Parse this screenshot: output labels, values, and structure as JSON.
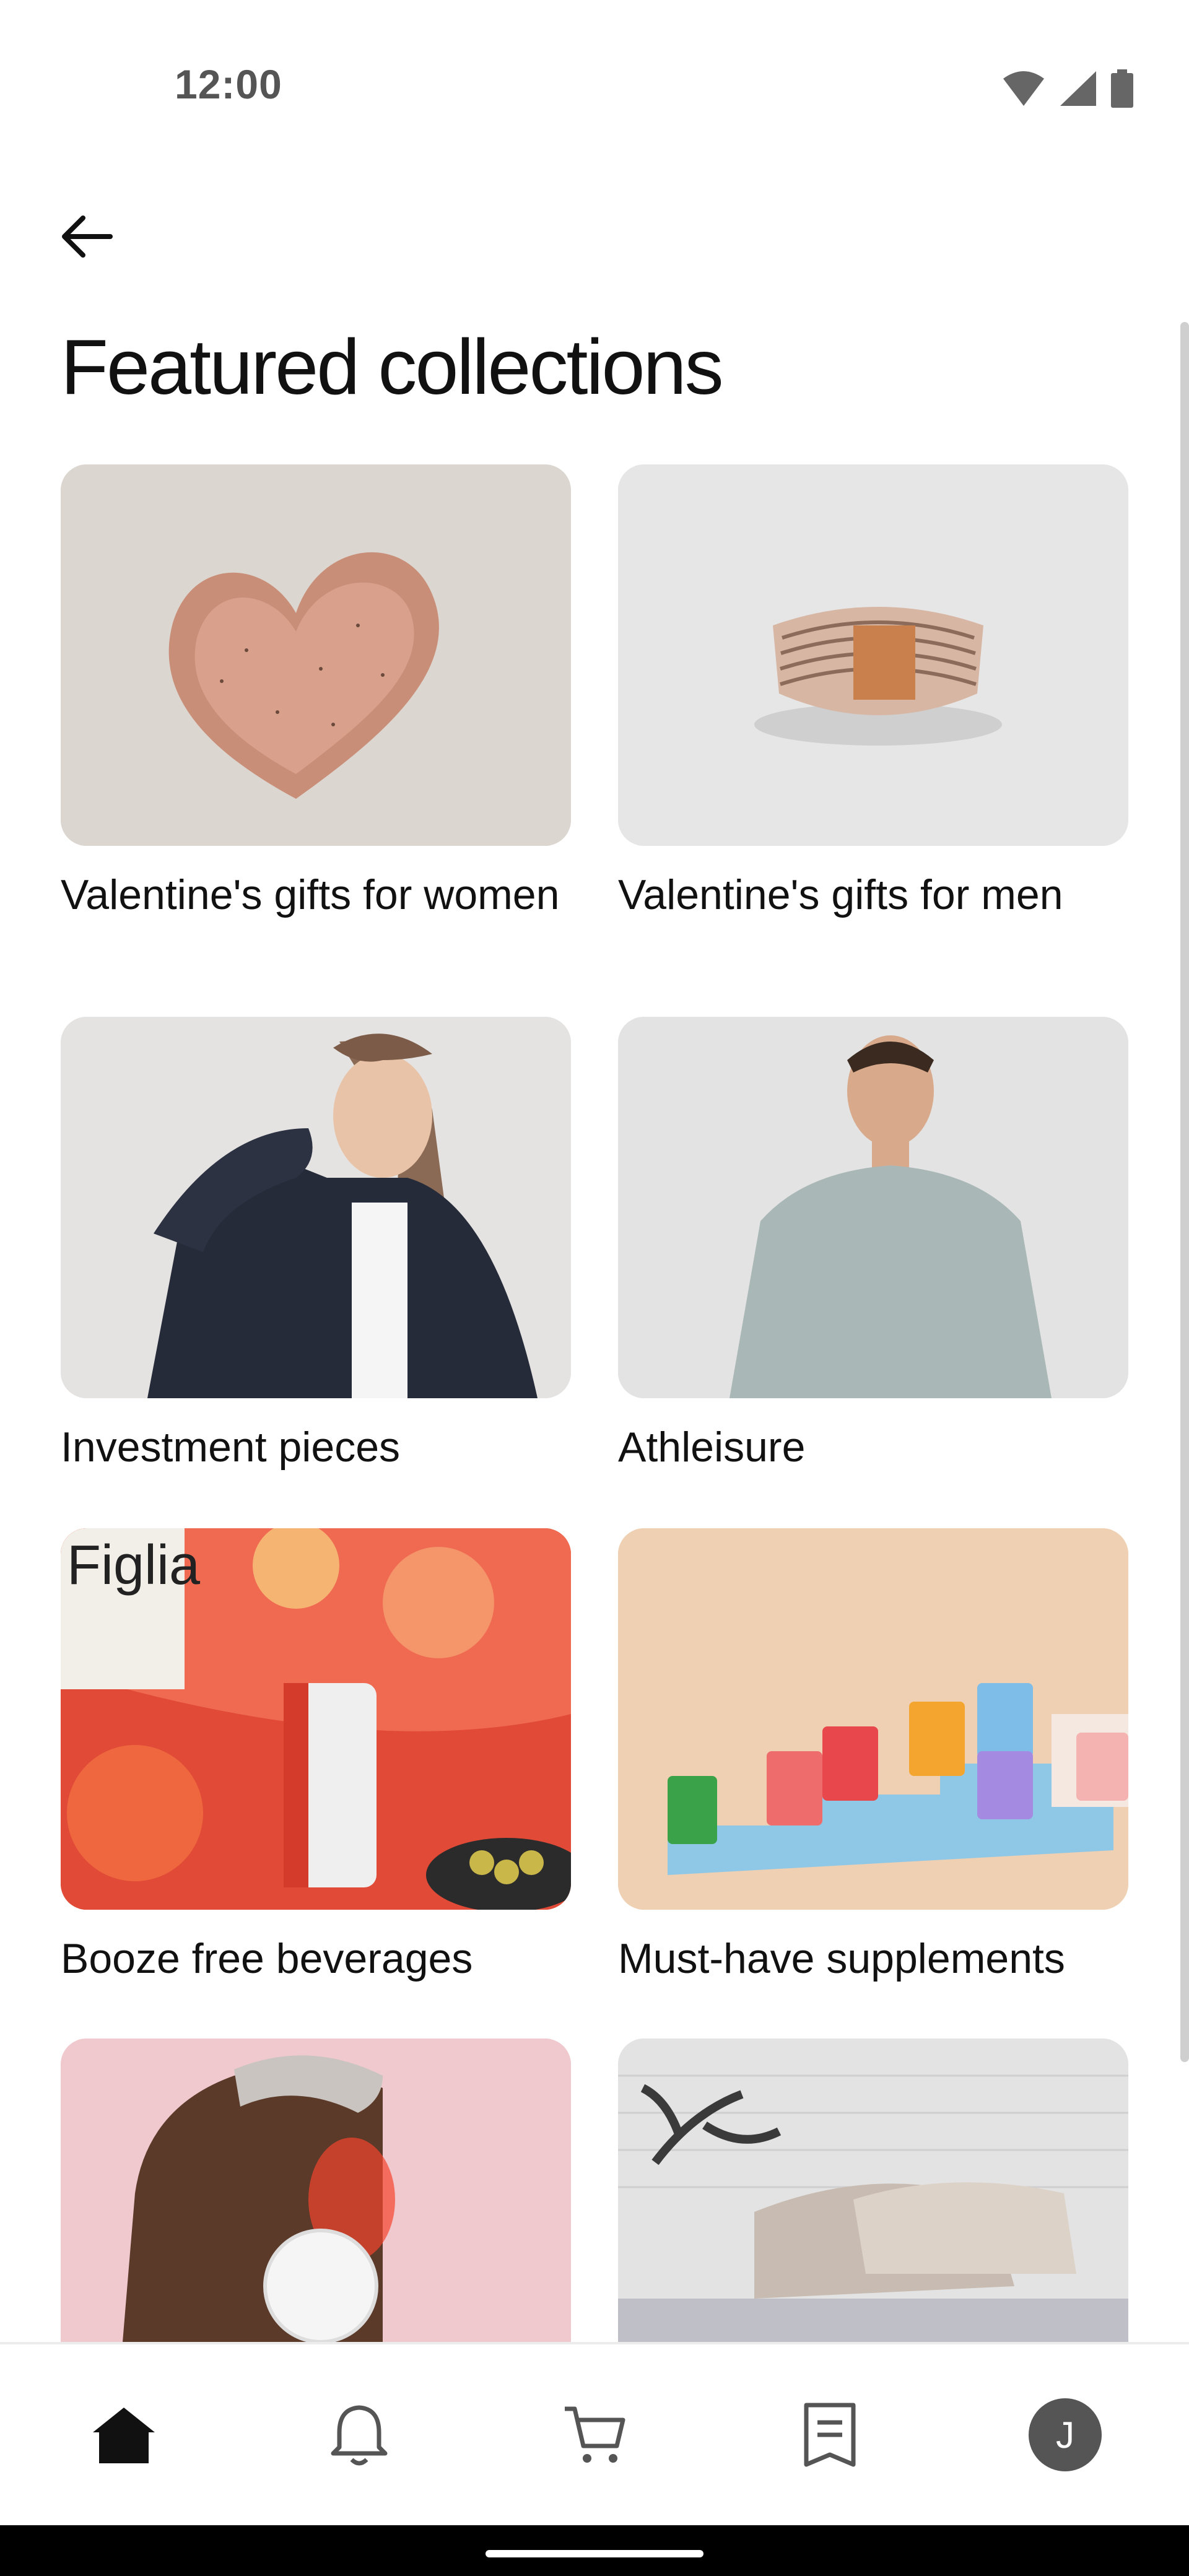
{
  "status_bar": {
    "time": "12:00"
  },
  "page": {
    "title": "Featured collections"
  },
  "collections": [
    {
      "label": "Valentine's gifts for women"
    },
    {
      "label": "Valentine's gifts for men"
    },
    {
      "label": "Investment pieces"
    },
    {
      "label": "Athleisure"
    },
    {
      "label": "Booze free beverages"
    },
    {
      "label": "Must-have supplements"
    },
    {
      "label": ""
    },
    {
      "label": ""
    }
  ],
  "bottom_nav": {
    "items": [
      "home-icon",
      "bell-icon",
      "cart-icon",
      "receipt-icon",
      "avatar"
    ],
    "avatar_initial": "J",
    "active": "home"
  }
}
